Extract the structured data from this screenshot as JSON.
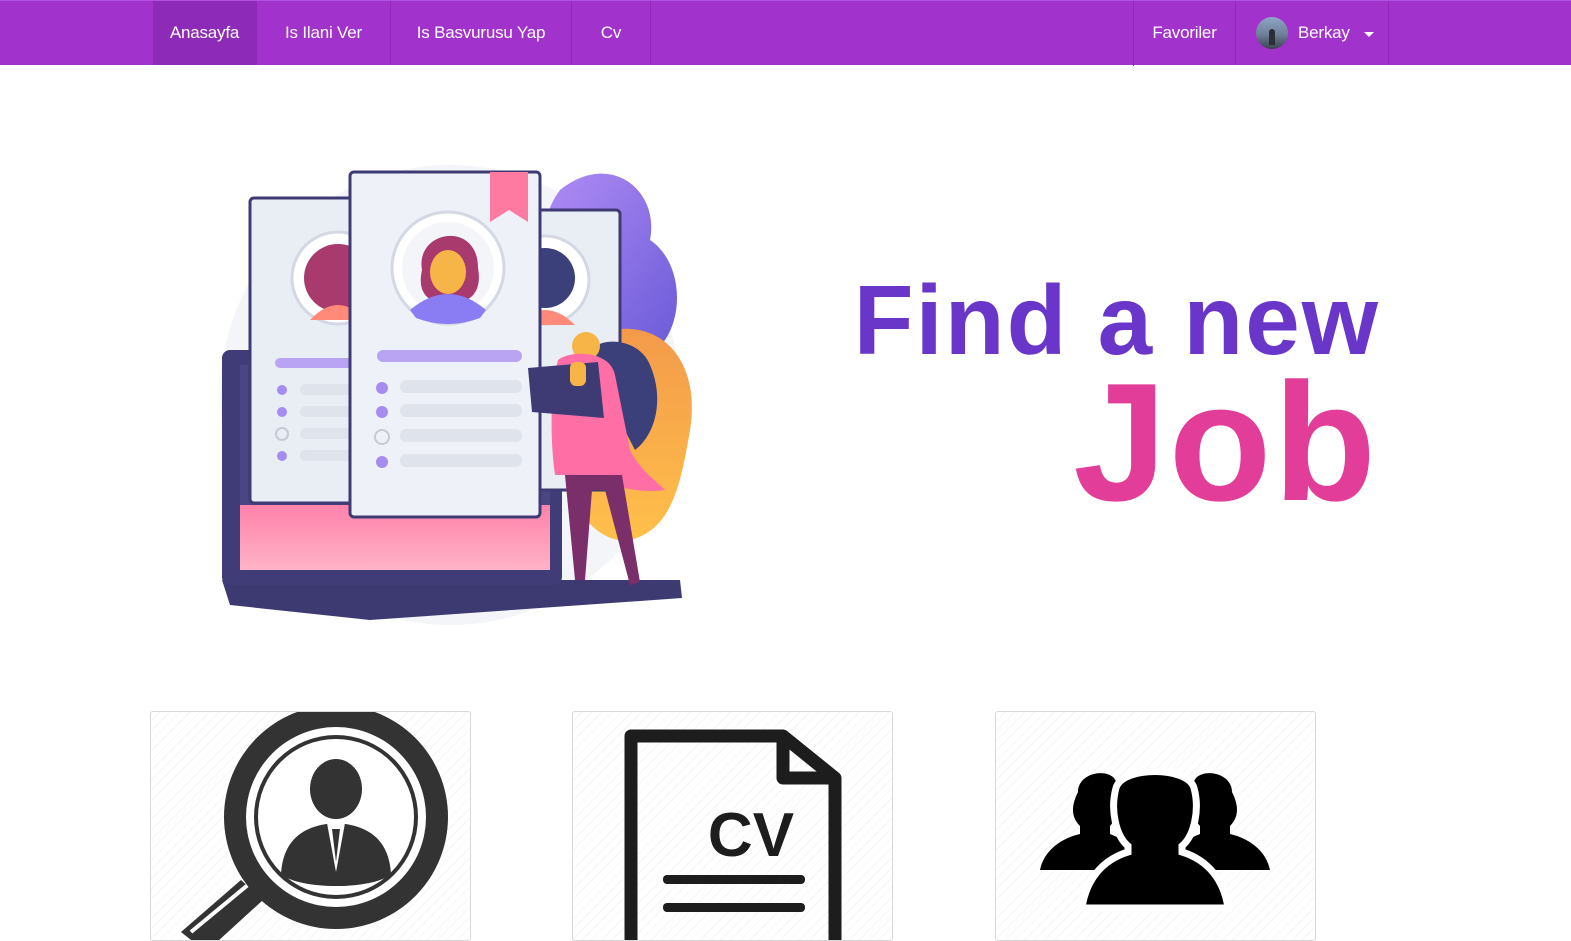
{
  "nav": {
    "items": [
      {
        "label": "Anasayfa",
        "active": true
      },
      {
        "label": "Is Ilani Ver",
        "active": false
      },
      {
        "label": "Is Basvurusu Yap",
        "active": false
      },
      {
        "label": "Cv",
        "active": false
      }
    ],
    "favorites_label": "Favoriler",
    "user_name": "Berkay"
  },
  "hero": {
    "line1": "Find a new",
    "line2": "Job"
  },
  "cards": [
    {
      "icon": "candidate-search-icon"
    },
    {
      "icon": "cv-document-icon",
      "icon_text": "CV"
    },
    {
      "icon": "people-group-icon"
    }
  ],
  "colors": {
    "navbar": "#a232cc",
    "navbar_active": "#8d2ab7",
    "hero_line1": "#6a35c9",
    "hero_line2": "#e23d98"
  }
}
